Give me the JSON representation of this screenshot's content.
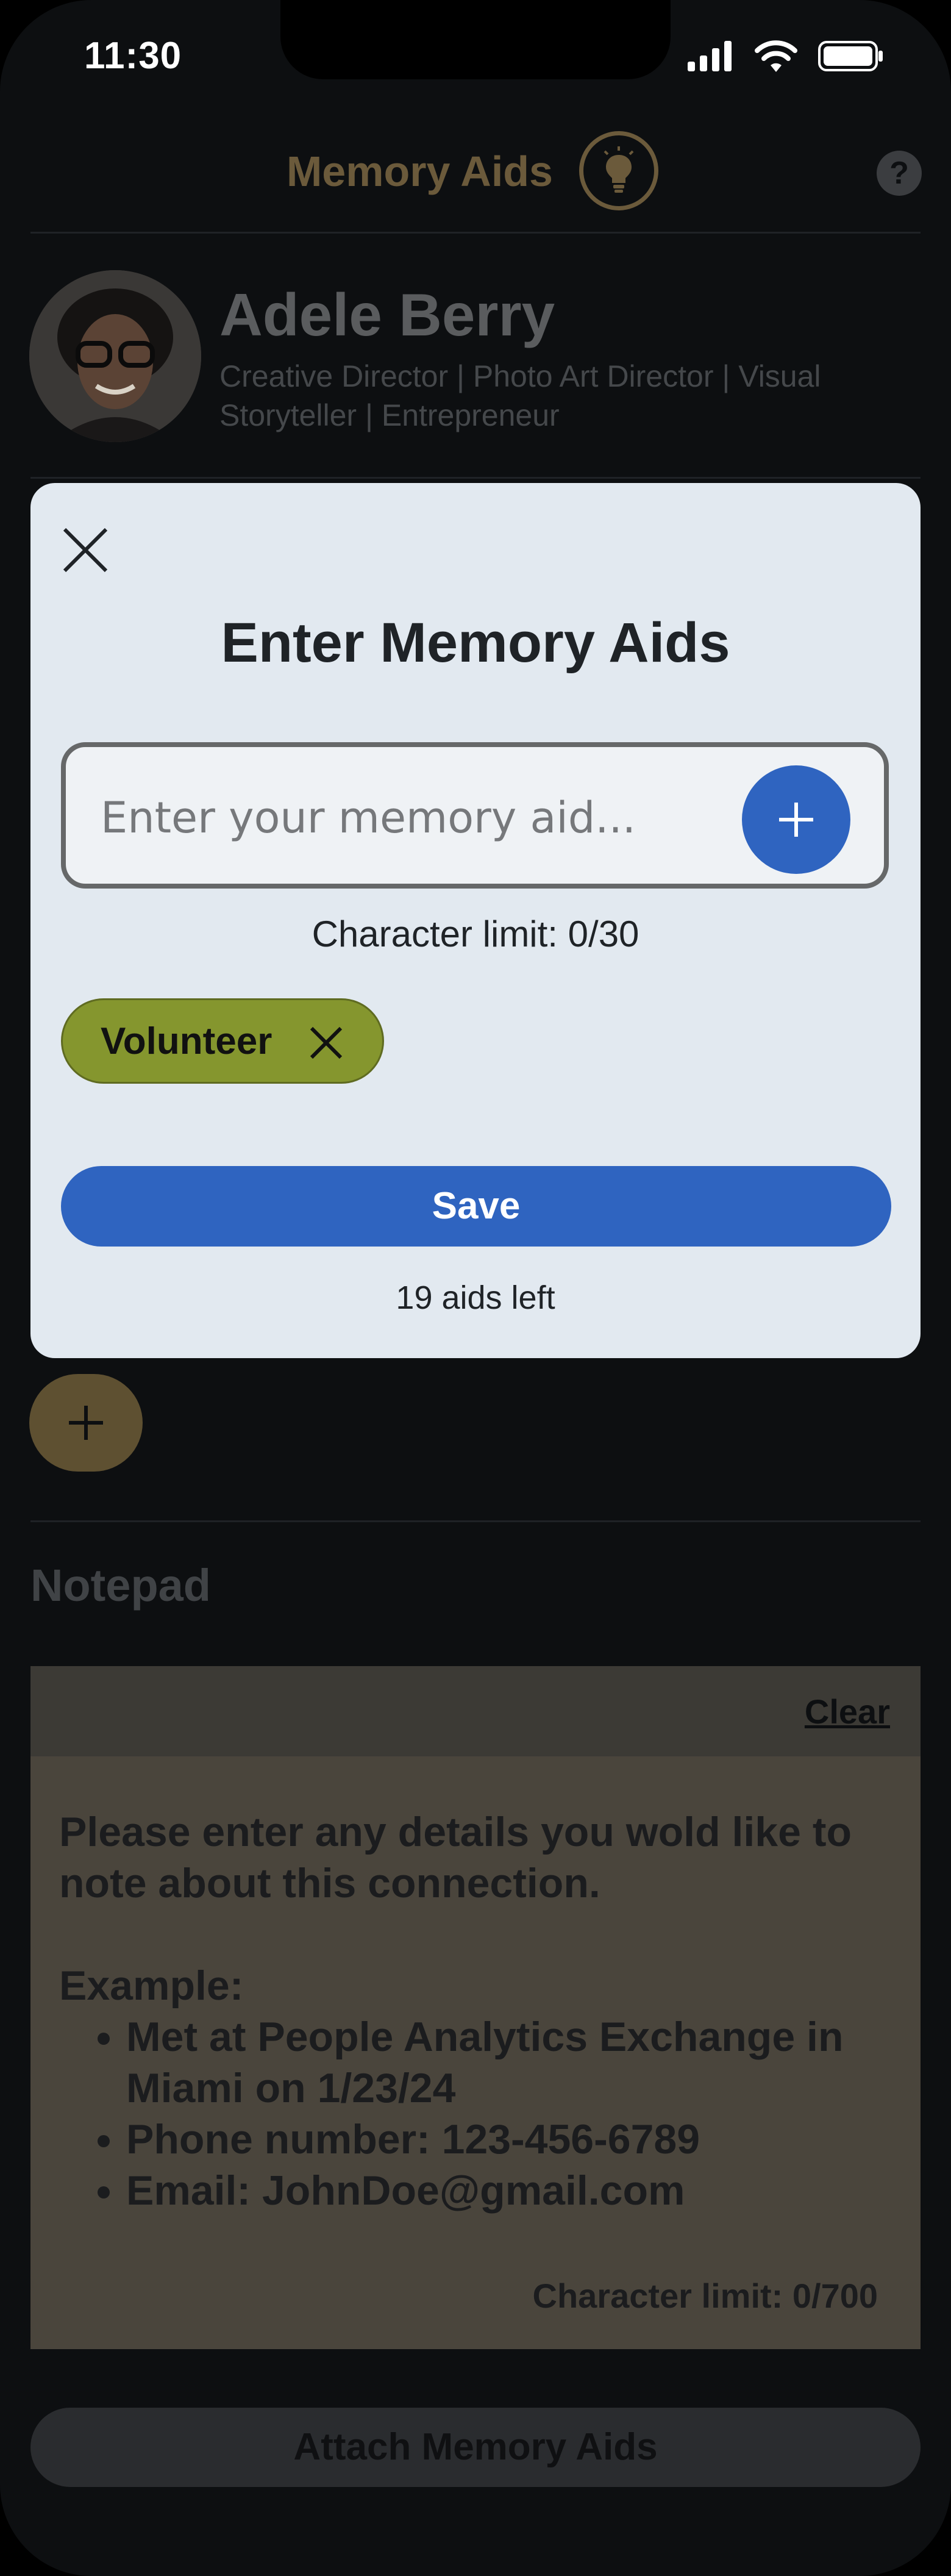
{
  "status_bar": {
    "time": "11:30",
    "icons": [
      "signal-icon",
      "wifi-icon",
      "battery-icon"
    ]
  },
  "header": {
    "title": "Memory Aids",
    "icon": "lightbulb-icon",
    "help_label": "?"
  },
  "contact": {
    "name": "Adele Berry",
    "subtitle": "Creative Director | Photo Art Director | Visual Storyteller | Entrepreneur"
  },
  "modal": {
    "title": "Enter Memory Aids",
    "input_placeholder": "Enter your memory aid...",
    "char_limit_text": "Character limit: 0/30",
    "chips": [
      {
        "label": "Volunteer"
      }
    ],
    "save_label": "Save",
    "aids_left_text": "19 aids left"
  },
  "notepad": {
    "title": "Notepad",
    "clear_label": "Clear",
    "intro_line": "Please enter any details you wold like to note about this connection.",
    "example_label": "Example:",
    "examples": [
      "Met at People Analytics Exchange in Miami on 1/23/24",
      "Phone number: 123-456-6789",
      "Email: JohnDoe@gmail.com"
    ],
    "char_limit_text": "Character limit: 0/700"
  },
  "footer": {
    "attach_label": "Attach Memory Aids"
  },
  "colors": {
    "accent_blue": "#2F64C0",
    "chip_olive": "#85962E",
    "modal_bg": "#E2E9F0",
    "dim_gold": "#6B5A3B"
  }
}
